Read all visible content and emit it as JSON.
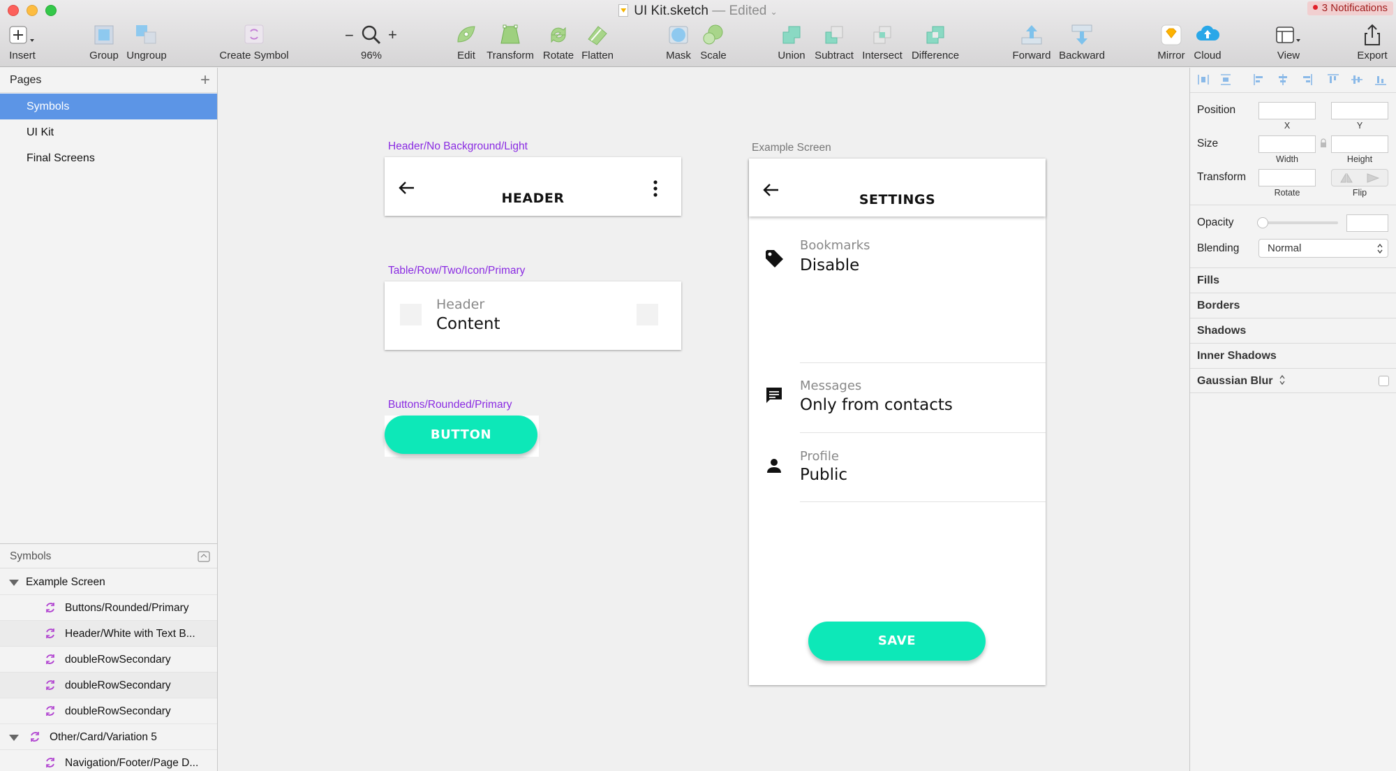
{
  "window": {
    "filename": "UI Kit.sketch",
    "separator": "—",
    "status": "Edited",
    "notifications": "3 Notifications"
  },
  "toolbar": {
    "insert": "Insert",
    "group": "Group",
    "ungroup": "Ungroup",
    "create_symbol": "Create Symbol",
    "zoom_minus": "−",
    "zoom_plus": "+",
    "zoom": "96%",
    "edit": "Edit",
    "transform": "Transform",
    "rotate": "Rotate",
    "flatten": "Flatten",
    "mask": "Mask",
    "scale": "Scale",
    "union": "Union",
    "subtract": "Subtract",
    "intersect": "Intersect",
    "difference": "Difference",
    "forward": "Forward",
    "backward": "Backward",
    "mirror": "Mirror",
    "cloud": "Cloud",
    "view": "View",
    "export": "Export"
  },
  "pages_panel": {
    "title": "Pages",
    "add_icon": "plus-icon",
    "pages": [
      "Symbols",
      "UI Kit",
      "Final Screens"
    ],
    "selected": "Symbols"
  },
  "layers_panel": {
    "title": "Symbols",
    "group1": "Example Screen",
    "items": [
      "Buttons/Rounded/Primary",
      "Header/White with Text B...",
      "doubleRowSecondary",
      "doubleRowSecondary",
      "doubleRowSecondary"
    ],
    "group2": "Other/Card/Variation 5",
    "group2_child": "Navigation/Footer/Page D..."
  },
  "canvas": {
    "header_symbol": {
      "label": "Header/No Background/Light",
      "title": "HEADER"
    },
    "table_row_symbol": {
      "label": "Table/Row/Two/Icon/Primary",
      "header": "Header",
      "content": "Content"
    },
    "button_symbol": {
      "label": "Buttons/Rounded/Primary",
      "text": "BUTTON"
    },
    "example_screen": {
      "label": "Example Screen",
      "title": "SETTINGS",
      "rows": [
        {
          "icon": "tag-icon",
          "title": "Bookmarks",
          "value": "Disable"
        },
        {
          "icon": "message-icon",
          "title": "Messages",
          "value": "Only from contacts"
        },
        {
          "icon": "person-icon",
          "title": "Profile",
          "value": "Public"
        }
      ],
      "save": "SAVE"
    },
    "accent": "#0de8b8",
    "symbol_label_color": "#8a2be2"
  },
  "inspector": {
    "position": "Position",
    "x": "X",
    "y": "Y",
    "size": "Size",
    "width": "Width",
    "height": "Height",
    "transform": "Transform",
    "rotate": "Rotate",
    "flip": "Flip",
    "opacity": "Opacity",
    "blending": "Blending",
    "blend_mode": "Normal",
    "sections": [
      "Fills",
      "Borders",
      "Shadows",
      "Inner Shadows",
      "Gaussian Blur"
    ]
  }
}
